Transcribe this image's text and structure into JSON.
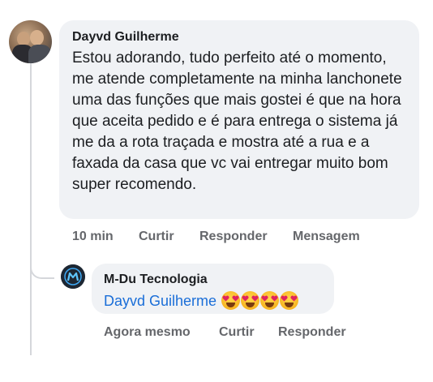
{
  "comment": {
    "author": "Dayvd Guilherme",
    "text": "Estou adorando, tudo perfeito até o momento, me atende completamente na minha lanchonete uma das funções que mais gostei é que na hora que aceita pedido e é para entrega o sistema já me da a rota traçada e mostra até a rua e a faxada da casa que vc vai entregar muito bom super recomendo.",
    "time": "10 min",
    "like_label": "Curtir",
    "reply_label": "Responder",
    "message_label": "Mensagem"
  },
  "reply": {
    "author": "M-Du Tecnologia",
    "mention": "Dayvd Guilherme",
    "emoji_count": 4,
    "emoji_icon": "heart-eyes-emoji",
    "time": "Agora mesmo",
    "like_label": "Curtir",
    "reply_label": "Responder"
  },
  "colors": {
    "bubble": "#f0f2f5",
    "text": "#1c1e21",
    "meta": "#65676b",
    "mention": "#1a6ed8",
    "thread_line": "#d5d7db"
  }
}
